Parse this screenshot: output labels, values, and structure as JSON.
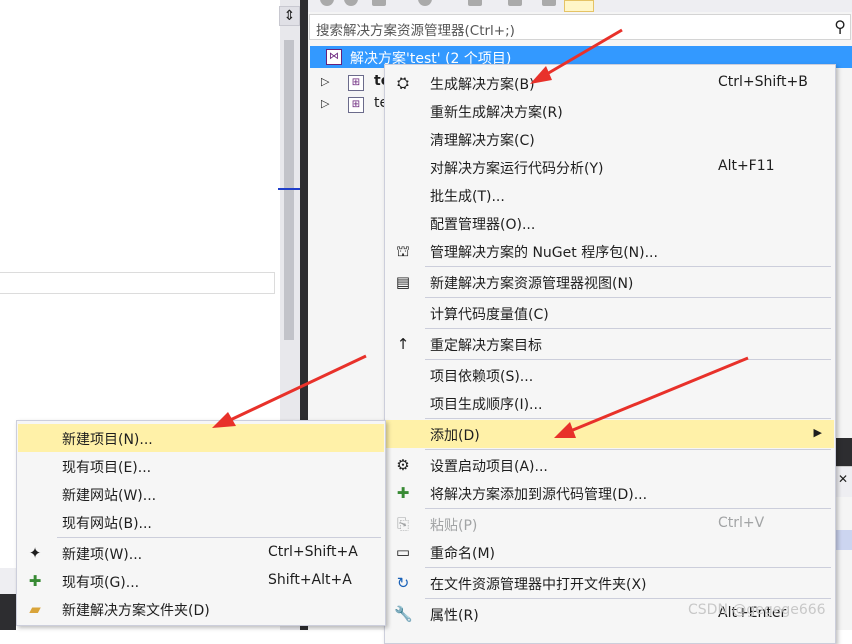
{
  "solution_explorer": {
    "search_placeholder": "搜索解决方案资源管理器(Ctrl+;)",
    "solution_label": "解决方案'test' (2 个项目)",
    "projects": [
      "te",
      "te"
    ]
  },
  "context_menu": {
    "items": [
      {
        "label": "生成解决方案(B)",
        "shortcut": "Ctrl+Shift+B",
        "icon": "build-icon"
      },
      {
        "label": "重新生成解决方案(R)",
        "shortcut": ""
      },
      {
        "label": "清理解决方案(C)",
        "shortcut": ""
      },
      {
        "label": "对解决方案运行代码分析(Y)",
        "shortcut": "Alt+F11"
      },
      {
        "label": "批生成(T)...",
        "shortcut": ""
      },
      {
        "label": "配置管理器(O)...",
        "shortcut": ""
      },
      {
        "label": "管理解决方案的 NuGet 程序包(N)...",
        "shortcut": "",
        "icon": "nuget-icon"
      },
      {
        "label": "新建解决方案资源管理器视图(N)",
        "shortcut": "",
        "icon": "new-view-icon"
      },
      {
        "label": "计算代码度量值(C)",
        "shortcut": ""
      },
      {
        "label": "重定解决方案目标",
        "shortcut": "",
        "icon": "up-arrow-icon"
      },
      {
        "label": "项目依赖项(S)...",
        "shortcut": ""
      },
      {
        "label": "项目生成顺序(I)...",
        "shortcut": ""
      },
      {
        "label": "添加(D)",
        "shortcut": ""
      },
      {
        "label": "设置启动项目(A)...",
        "shortcut": "",
        "icon": "gear-icon"
      },
      {
        "label": "将解决方案添加到源代码管理(D)...",
        "shortcut": "",
        "icon": "source-control-icon"
      },
      {
        "label": "粘贴(P)",
        "shortcut": "Ctrl+V",
        "icon": "paste-icon"
      },
      {
        "label": "重命名(M)",
        "shortcut": "",
        "icon": "rename-icon"
      },
      {
        "label": "在文件资源管理器中打开文件夹(X)",
        "shortcut": "",
        "icon": "open-folder-icon"
      },
      {
        "label": "属性(R)",
        "shortcut": "Alt+Enter",
        "icon": "wrench-icon"
      }
    ]
  },
  "submenu": {
    "items": [
      {
        "label": "新建项目(N)...",
        "shortcut": ""
      },
      {
        "label": "现有项目(E)...",
        "shortcut": ""
      },
      {
        "label": "新建网站(W)...",
        "shortcut": ""
      },
      {
        "label": "现有网站(B)...",
        "shortcut": ""
      },
      {
        "label": "新建项(W)...",
        "shortcut": "Ctrl+Shift+A",
        "icon": "new-item-icon"
      },
      {
        "label": "现有项(G)...",
        "shortcut": "Shift+Alt+A",
        "icon": "existing-item-icon"
      },
      {
        "label": "新建解决方案文件夹(D)",
        "shortcut": "",
        "icon": "new-folder-icon"
      }
    ]
  },
  "watermark": "CSDN @gegege666",
  "colors": {
    "selection": "#3399ff",
    "highlight": "#fff1a8",
    "arrow": "#e8312a"
  }
}
